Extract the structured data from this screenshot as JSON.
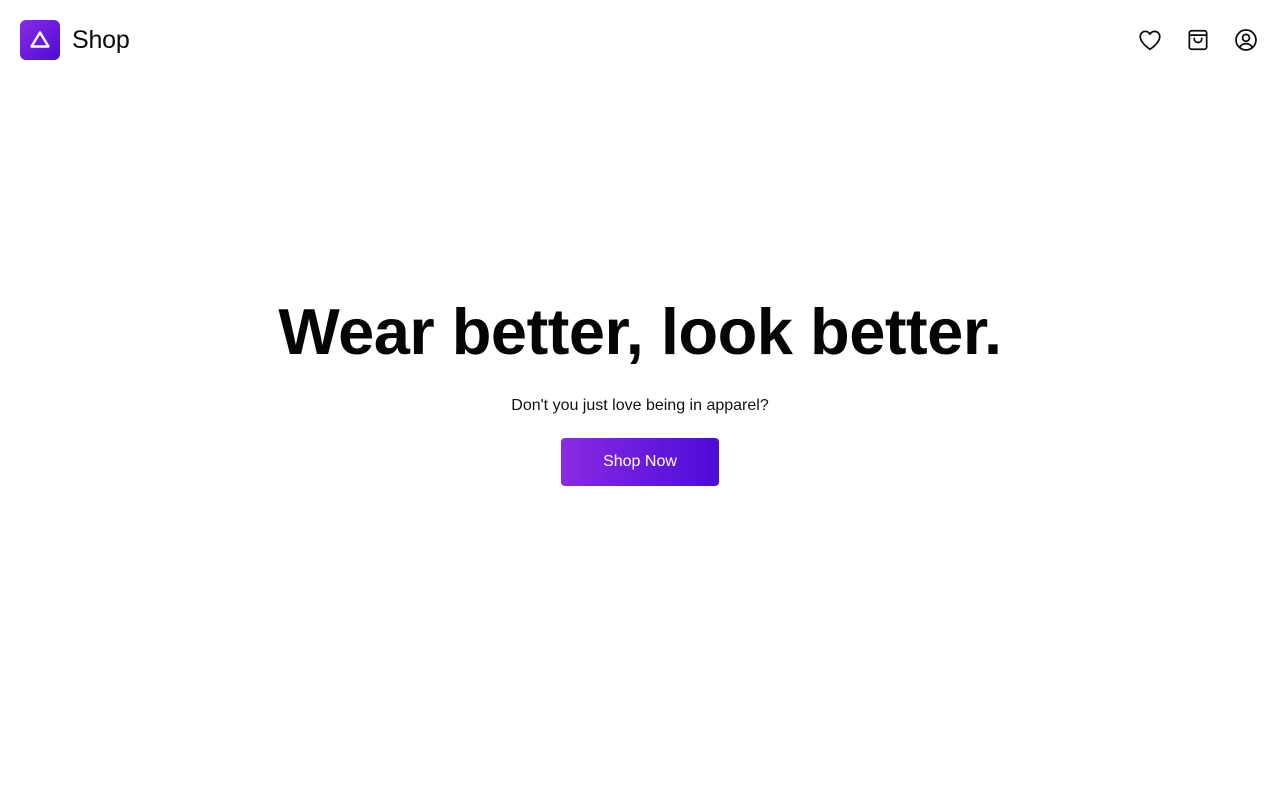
{
  "header": {
    "brand_name": "Shop",
    "icons": {
      "logo": "triangle-logo-icon",
      "wishlist": "heart-icon",
      "cart": "shopping-bag-icon",
      "account": "user-circle-icon"
    }
  },
  "hero": {
    "headline": "Wear better, look better.",
    "subtitle": "Don't you just love being in apparel?",
    "cta_label": "Shop Now"
  },
  "colors": {
    "brand_gradient_start": "#8a2be2",
    "brand_gradient_end": "#4c0bd9",
    "background": "#ffffff",
    "text": "#0a0a0a"
  }
}
